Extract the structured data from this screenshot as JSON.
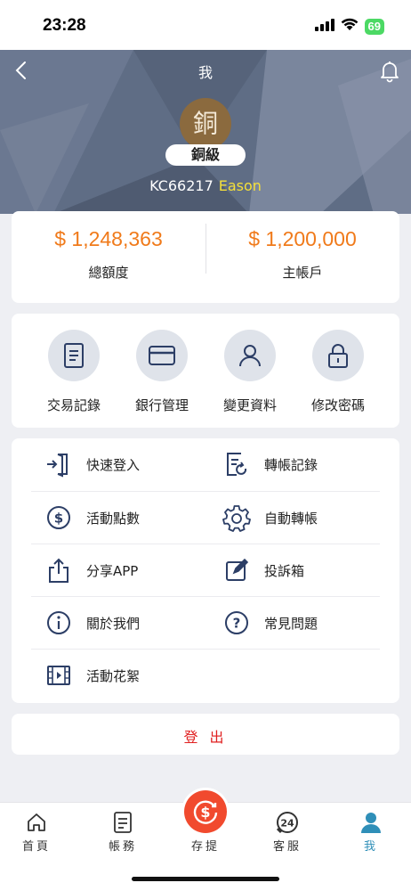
{
  "status_bar": {
    "time": "23:28",
    "battery": "69"
  },
  "header": {
    "title": "我",
    "avatar_char": "銅",
    "level": "銅級",
    "user_id": "KC66217",
    "user_name": "Eason"
  },
  "balances": [
    {
      "amount": "$ 1,248,363",
      "label": "總額度"
    },
    {
      "amount": "$ 1,200,000",
      "label": "主帳戶"
    }
  ],
  "quick_actions": [
    {
      "label": "交易記錄",
      "icon": "document-icon"
    },
    {
      "label": "銀行管理",
      "icon": "credit-card-icon"
    },
    {
      "label": "變更資料",
      "icon": "user-icon"
    },
    {
      "label": "修改密碼",
      "icon": "lock-icon"
    }
  ],
  "menu": [
    {
      "label": "快速登入",
      "icon": "login-door-icon"
    },
    {
      "label": "轉帳記錄",
      "icon": "transfer-record-icon"
    },
    {
      "label": "活動點數",
      "icon": "dollar-circle-icon"
    },
    {
      "label": "自動轉帳",
      "icon": "gear-icon"
    },
    {
      "label": "分享APP",
      "icon": "share-icon"
    },
    {
      "label": "投訴箱",
      "icon": "edit-icon"
    },
    {
      "label": "關於我們",
      "icon": "info-icon"
    },
    {
      "label": "常見問題",
      "icon": "question-icon"
    },
    {
      "label": "活動花絮",
      "icon": "film-icon"
    }
  ],
  "logout_label": "登 出",
  "tabs": [
    {
      "label": "首頁",
      "icon": "home-icon"
    },
    {
      "label": "帳務",
      "icon": "ledger-icon"
    },
    {
      "label": "存提",
      "icon": "deposit-dollar-icon"
    },
    {
      "label": "客服",
      "icon": "support-24-icon"
    },
    {
      "label": "我",
      "icon": "person-icon",
      "active": true
    }
  ],
  "colors": {
    "accent_orange": "#f07a1a",
    "logout_red": "#e02020",
    "active_tab": "#2f8fb8",
    "header_bg": "#5f6d85",
    "name_yellow": "#f5e03a"
  }
}
